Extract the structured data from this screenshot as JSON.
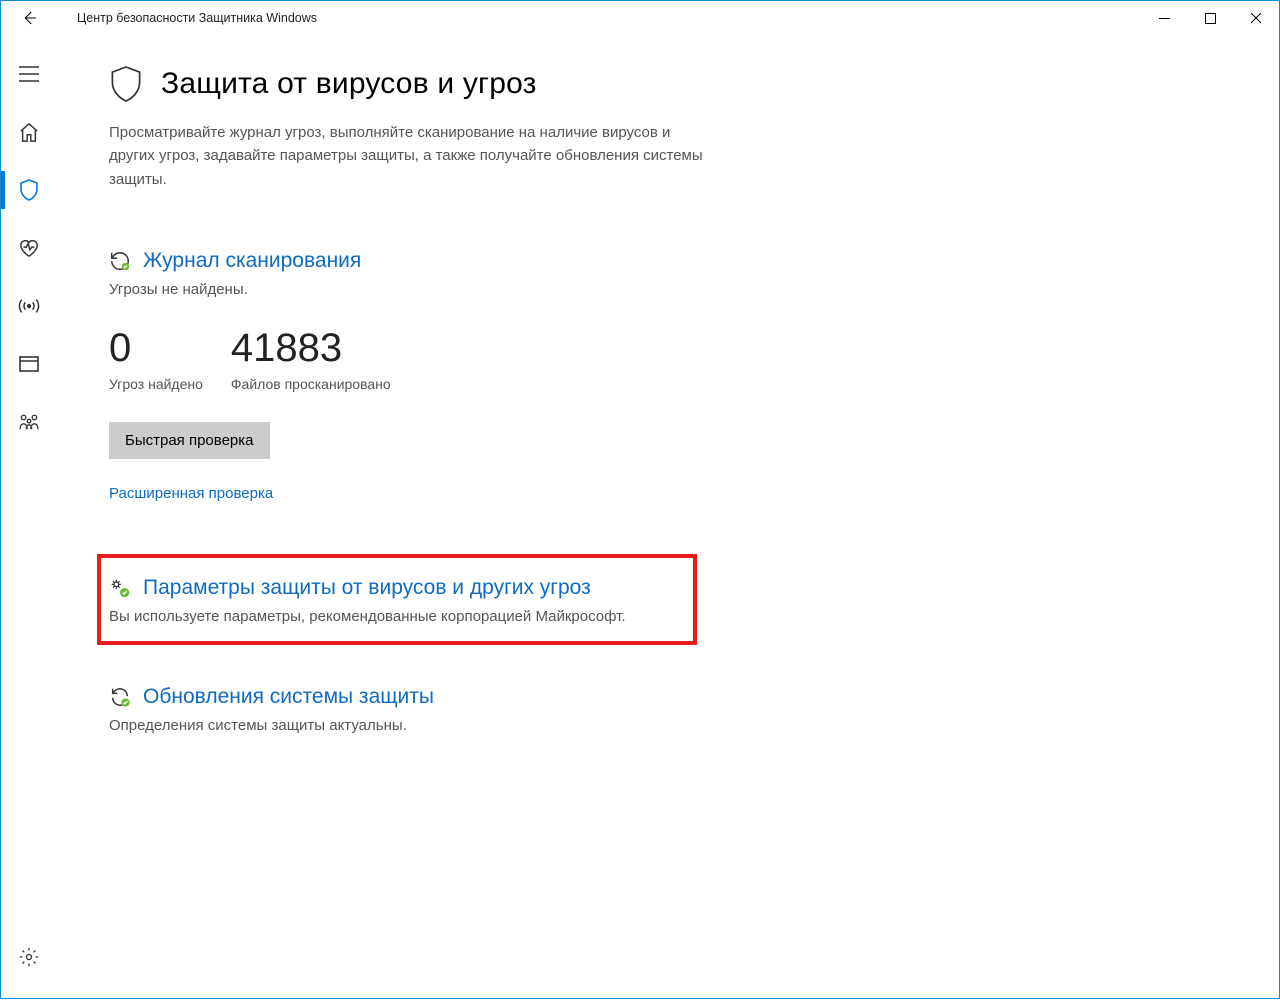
{
  "window": {
    "title": "Центр безопасности Защитника Windows"
  },
  "page": {
    "title": "Защита от вирусов и угроз",
    "description": "Просматривайте журнал угроз, выполняйте сканирование на наличие вирусов и других угроз, задавайте параметры защиты, а также получайте обновления системы защиты."
  },
  "scan": {
    "heading": "Журнал сканирования",
    "status": "Угрозы не найдены.",
    "threats_count": "0",
    "threats_label": "Угроз найдено",
    "files_count": "41883",
    "files_label": "Файлов просканировано",
    "quick_button": "Быстрая проверка",
    "advanced_link": "Расширенная проверка"
  },
  "settings": {
    "heading": "Параметры защиты от вирусов и других угроз",
    "status": "Вы используете параметры, рекомендованные корпорацией Майкрософт."
  },
  "updates": {
    "heading": "Обновления системы защиты",
    "status": "Определения системы защиты актуальны."
  }
}
